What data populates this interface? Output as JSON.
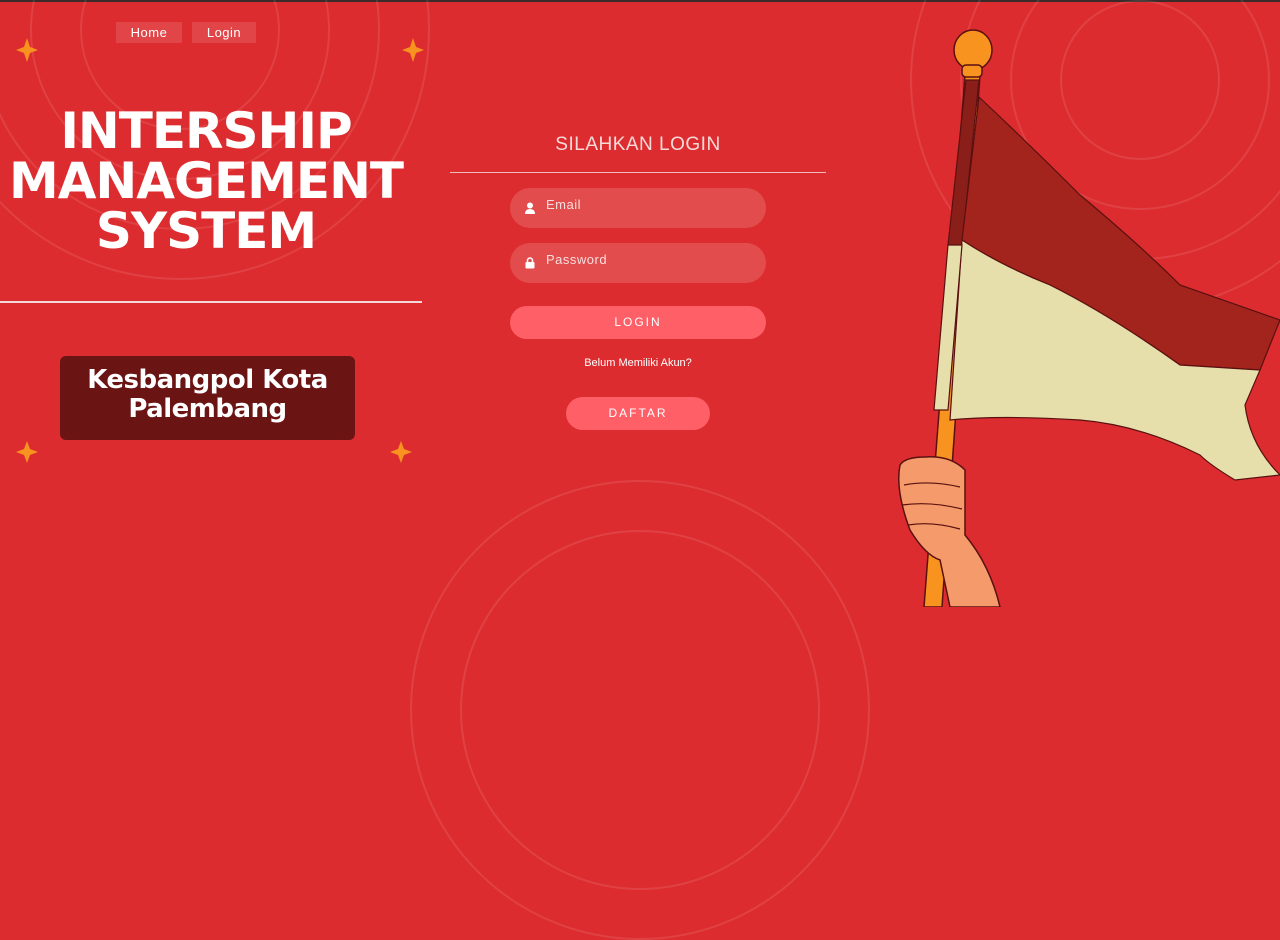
{
  "nav": {
    "home": "Home",
    "login": "Login"
  },
  "hero": {
    "line1": "INTERSHIP",
    "line2": "MANAGEMENT",
    "line3": "SYSTEM"
  },
  "org": {
    "line1": "Kesbangpol Kota",
    "line2": "Palembang"
  },
  "form": {
    "title": "SILAHKAN LOGIN",
    "email_placeholder": "Email",
    "password_placeholder": "Password",
    "login_label": "LOGIN",
    "no_account_text": "Belum Memiliki Akun?",
    "register_label": "DAFTAR"
  },
  "colors": {
    "background": "#dd2c2f",
    "button": "#ff5f67",
    "org_box": "#6b1414",
    "sparkle": "#f7931e"
  }
}
